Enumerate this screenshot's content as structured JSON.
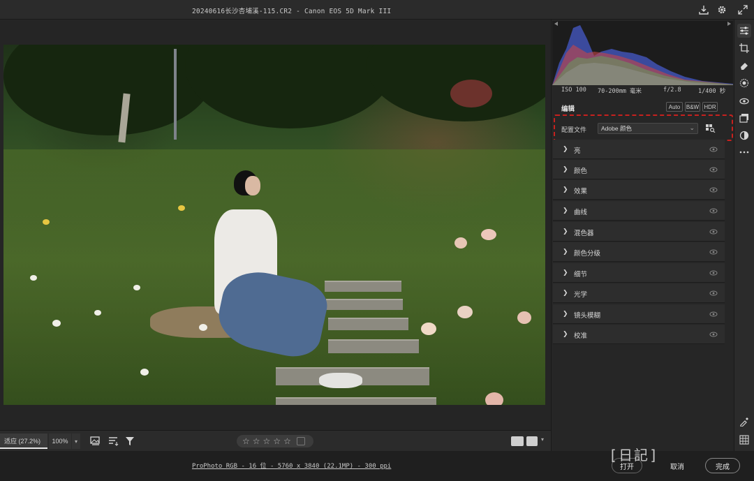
{
  "window": {
    "title": "20240616长沙杏埔溪-115.CR2 -  Canon EOS 5D Mark III"
  },
  "toolbar": {
    "icons": [
      "download-icon",
      "gear-icon",
      "expand-icon"
    ]
  },
  "exif": {
    "iso": "ISO 100",
    "lens": "70-200mm 毫米",
    "aperture": "f/2.8",
    "shutter": "1/400 秒"
  },
  "edit_panel": {
    "title": "编辑",
    "modes": [
      "Auto",
      "B&W",
      "HDR"
    ],
    "profile_label": "配置文件",
    "profile_value": "Adobe 颜色",
    "highlight_color": "#c7211e",
    "sections": [
      "亮",
      "颜色",
      "效果",
      "曲线",
      "混色器",
      "颜色分级",
      "细节",
      "光学",
      "镜头模糊",
      "校准"
    ]
  },
  "bottom_bar": {
    "zoom_fit": "适应 (27.2%)",
    "zoom_100": "100%",
    "rating_stars": 5
  },
  "status": {
    "info": "ProPhoto RGB - 16 位 - 5760 x 3840 (22.1MP) - 300 ppi"
  },
  "actions": {
    "open": "打开",
    "cancel": "取消",
    "done": "完成"
  },
  "watermark": "[日記]"
}
